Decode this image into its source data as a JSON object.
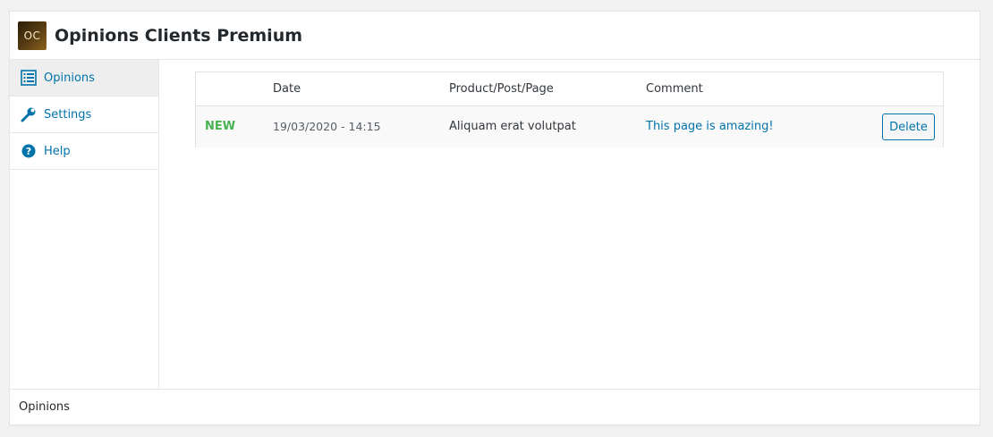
{
  "header": {
    "logo_text": "OC",
    "title": "Opinions Clients Premium"
  },
  "sidebar": {
    "items": [
      {
        "label": "Opinions",
        "icon": "list-icon",
        "active": true
      },
      {
        "label": "Settings",
        "icon": "wrench-icon",
        "active": false
      },
      {
        "label": "Help",
        "icon": "help-icon",
        "active": false
      }
    ]
  },
  "table": {
    "columns": [
      "",
      "Date",
      "Product/Post/Page",
      "Comment",
      ""
    ],
    "rows": [
      {
        "status": "NEW",
        "date": "19/03/2020 - 14:15",
        "product": "Aliquam erat volutpat",
        "comment": "This page is amazing!",
        "action": "Delete"
      }
    ]
  },
  "footer": {
    "label": "Opinions"
  },
  "colors": {
    "link": "#0073aa",
    "new_status": "#46b450",
    "active_nav_bg": "#eeeeee"
  }
}
